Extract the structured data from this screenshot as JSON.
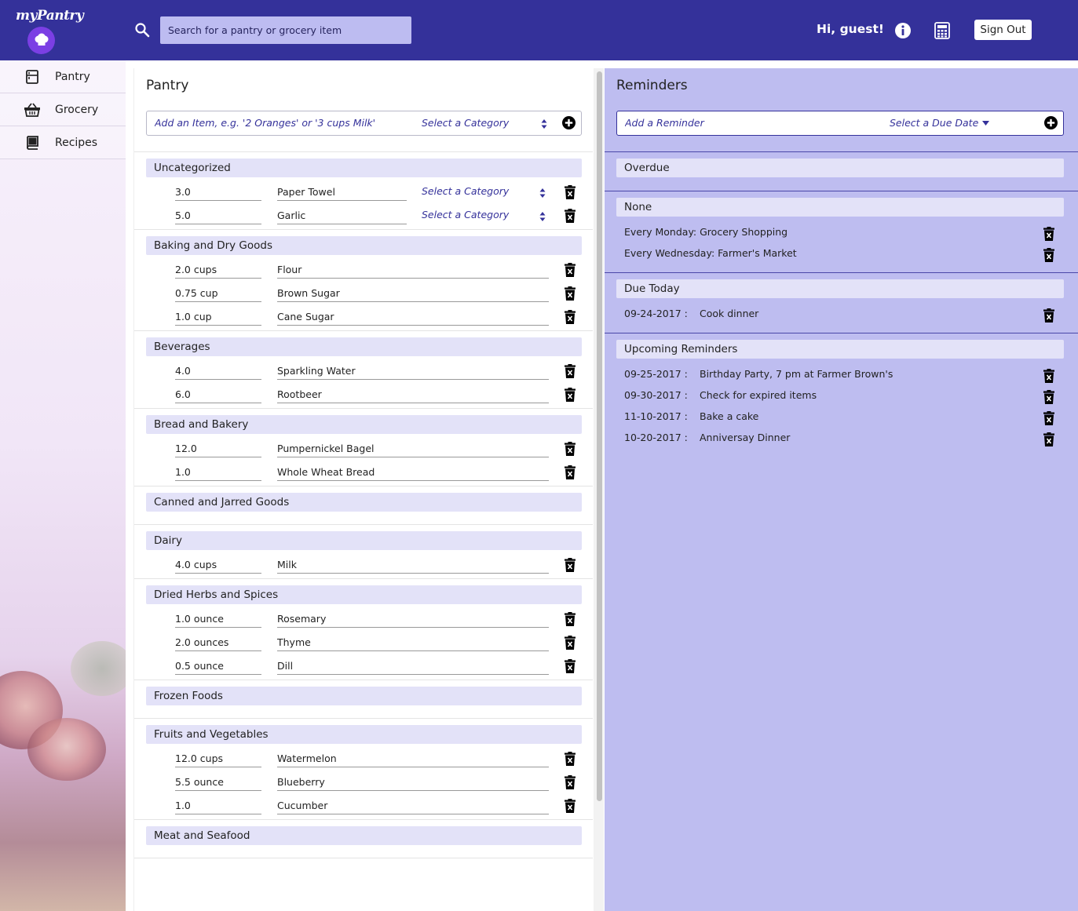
{
  "header": {
    "logo_text": "myPantry",
    "search_placeholder": "Search for a pantry or grocery item",
    "greeting": "Hi,  guest!",
    "sign_out": "Sign Out"
  },
  "sidebar": {
    "items": [
      {
        "label": "Pantry",
        "icon": "fridge-icon"
      },
      {
        "label": "Grocery",
        "icon": "basket-icon"
      },
      {
        "label": "Recipes",
        "icon": "book-icon"
      }
    ]
  },
  "pantry": {
    "title": "Pantry",
    "add_placeholder": "Add an Item, e.g. '2 Oranges' or '3 cups Milk'",
    "select_category": "Select a Category",
    "categories": [
      {
        "name": "Uncategorized",
        "items": [
          {
            "qty": "3.0",
            "name": "Paper Towel",
            "category": "Select a Category"
          },
          {
            "qty": "5.0",
            "name": "Garlic",
            "category": "Select a Category"
          }
        ]
      },
      {
        "name": "Baking and Dry Goods",
        "items": [
          {
            "qty": "2.0 cups",
            "name": "Flour"
          },
          {
            "qty": "0.75 cup",
            "name": "Brown  Sugar"
          },
          {
            "qty": "1.0 cup",
            "name": "Cane  Sugar"
          }
        ]
      },
      {
        "name": "Beverages",
        "items": [
          {
            "qty": "4.0",
            "name": "Sparkling Water"
          },
          {
            "qty": "6.0",
            "name": "Rootbeer"
          }
        ]
      },
      {
        "name": "Bread and Bakery",
        "items": [
          {
            "qty": "12.0",
            "name": "Pumpernickel  Bagel"
          },
          {
            "qty": "1.0",
            "name": "Whole Wheat  Bread"
          }
        ]
      },
      {
        "name": "Canned and Jarred Goods",
        "items": []
      },
      {
        "name": "Dairy",
        "items": [
          {
            "qty": "4.0 cups",
            "name": "Milk"
          }
        ]
      },
      {
        "name": "Dried Herbs and Spices",
        "items": [
          {
            "qty": "1.0 ounce",
            "name": "Rosemary"
          },
          {
            "qty": "2.0 ounces",
            "name": "Thyme"
          },
          {
            "qty": "0.5 ounce",
            "name": "Dill"
          }
        ]
      },
      {
        "name": "Frozen Foods",
        "items": []
      },
      {
        "name": "Fruits and Vegetables",
        "items": [
          {
            "qty": "12.0 cups",
            "name": "Watermelon"
          },
          {
            "qty": "5.5 ounce",
            "name": "Blueberry"
          },
          {
            "qty": "1.0",
            "name": "Cucumber"
          }
        ]
      },
      {
        "name": "Meat and Seafood",
        "items": []
      }
    ]
  },
  "reminders": {
    "title": "Reminders",
    "add_placeholder": "Add a Reminder",
    "select_due_date": "Select a Due Date",
    "groups": [
      {
        "name": "Overdue",
        "items": []
      },
      {
        "name": "None",
        "items": [
          {
            "date": "",
            "text": "Every Monday: Grocery Shopping"
          },
          {
            "date": "",
            "text": "Every Wednesday: Farmer's Market"
          }
        ]
      },
      {
        "name": "Due Today",
        "items": [
          {
            "date": "09-24-2017 :",
            "text": "Cook dinner"
          }
        ]
      },
      {
        "name": "Upcoming Reminders",
        "items": [
          {
            "date": "09-25-2017 :",
            "text": "Birthday Party, 7 pm at Farmer Brown's"
          },
          {
            "date": "09-30-2017 :",
            "text": "Check for expired items"
          },
          {
            "date": "11-10-2017 :",
            "text": "Bake a cake"
          },
          {
            "date": "10-20-2017 :",
            "text": "Anniversay Dinner"
          }
        ]
      }
    ]
  },
  "colors": {
    "header_bg": "#34319a",
    "accent": "#34319a",
    "category_header_bg": "#e3e2f8",
    "reminders_bg": "#bebdf0",
    "search_bg": "#bdbcf1"
  }
}
